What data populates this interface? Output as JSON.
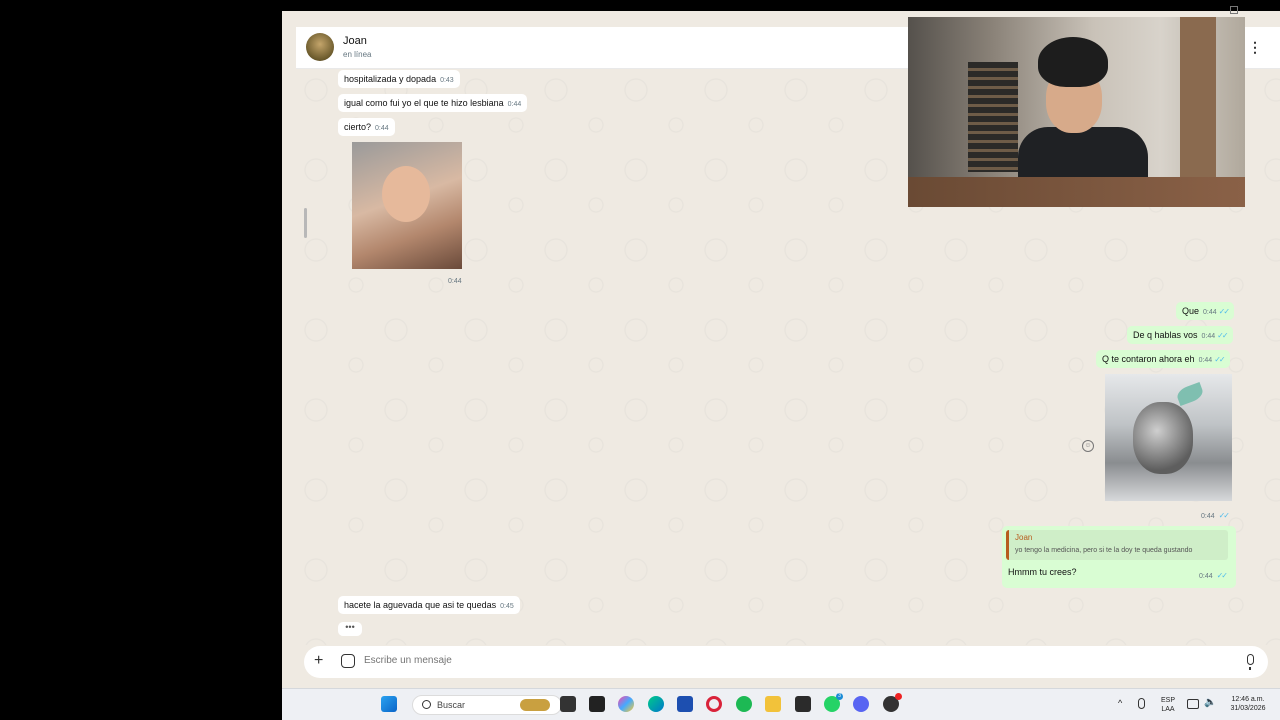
{
  "contact": {
    "name": "Joan",
    "status": "en línea"
  },
  "messages": {
    "in1": {
      "text": "hospitalizada y dopada",
      "time": "0:43"
    },
    "in2": {
      "text": "igual como fui yo el que te hizo lesbiana",
      "time": "0:44"
    },
    "in3": {
      "text": "cierto?",
      "time": "0:44"
    },
    "in_img_time": "0:44",
    "out1": {
      "text": "Que",
      "time": "0:44"
    },
    "out2": {
      "text": "De q hablas vos",
      "time": "0:44"
    },
    "out3": {
      "text": "Q te contaron ahora eh",
      "time": "0:44"
    },
    "out_img_time": "0:44",
    "reply": {
      "quoted_author": "Joan",
      "quoted_text": "yo tengo la medicina, pero si te la doy te queda gustando",
      "text": "Hmmm tu crees?",
      "time": "0:44"
    },
    "in4": {
      "text": "hacete la aguevada que asi te quedas",
      "time": "0:45"
    },
    "typing": "•••"
  },
  "composer": {
    "placeholder": "Escribe un mensaje"
  },
  "taskbar": {
    "search_label": "Buscar",
    "lang_top": "ESP",
    "lang_bottom": "LAA",
    "time": "12:46 a.m.",
    "date": "31/03/2026",
    "whatsapp_badge": "3"
  },
  "colors": {
    "outgoing_bubble": "#d9fdd3",
    "incoming_bubble": "#ffffff",
    "chat_bg": "#efeae2",
    "read_ticks": "#53bdeb"
  },
  "icons": [
    "menu-icon",
    "plus-icon",
    "sticker-icon",
    "mic-icon",
    "emoji-icon",
    "windows-start-icon",
    "search-icon"
  ]
}
